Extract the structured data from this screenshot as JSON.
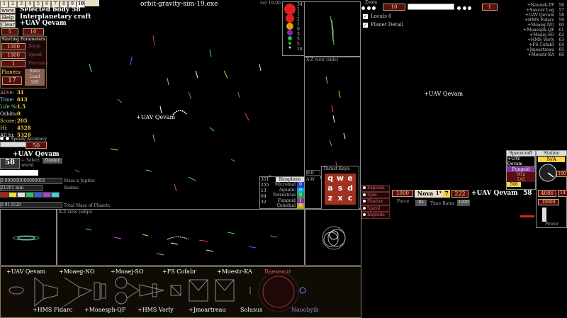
{
  "header": {
    "tabs": [
      "1",
      "2",
      "3",
      "4",
      "5",
      "6",
      "7",
      "8",
      "9",
      "10"
    ],
    "selected_body": "Selected body 58",
    "craft_type": "Interplanetary craft",
    "target_name": "+UAV Qevam",
    "window_title": "orbit-gravity-sim-19.exe",
    "version": "ver 19.00"
  },
  "left_buttons": {
    "www": "www",
    "help": "Help",
    "clear": "Clear"
  },
  "selector": {
    "value_left": "5",
    "value_right": "10"
  },
  "params": {
    "title": "Starting Parameters",
    "rows": [
      {
        "value": "1000",
        "label": "Zoom"
      },
      {
        "value": "1000",
        "label": "Speed"
      },
      {
        "value": "1",
        "label": "Precision"
      }
    ],
    "planets_label": "Planets:",
    "planets_value": "17",
    "save": "Save",
    "load": "Load",
    "hundred": "100"
  },
  "stats": [
    {
      "label": "Alive:",
      "value": "31"
    },
    {
      "label": "Time:",
      "value": "613"
    },
    {
      "label": "Life %:",
      "value": "1.5"
    },
    {
      "label": "Orbits:",
      "value": "0"
    },
    {
      "label": "Score:",
      "value": "205"
    },
    {
      "label": "Hi:",
      "value": "4528"
    },
    {
      "label": "All hi:",
      "value": "5320"
    }
  ],
  "speed_accuracy": {
    "label": "Speed/ Accuracy",
    "value": "50"
  },
  "body_panel": {
    "name": "+UAV Qevam",
    "number": "58",
    "select_world": "← Select\nworld",
    "gamer_tab": "Gamer",
    "mass_text": "Mass x Jupiter",
    "mass_value": "0.000000000000001",
    "radius_value": "21201 mm",
    "radius_text": "Radius",
    "total_mass_value": "0.913528",
    "total_mass_text": "Total Mass of Planets",
    "colors": [
      "#c21818",
      "#f0e020",
      "#e0e0e0",
      "#30c060",
      "#3060e0",
      "#b040c0",
      "#40d0e0"
    ]
  },
  "main_view": {
    "ship_label": "+UAV Qevam"
  },
  "xz_view": {
    "title": "X-Z view (side)"
  },
  "xz_edge": {
    "title": "X-Z view (edge)"
  },
  "legend_values": [
    "34",
    "1",
    "1",
    "2",
    "1",
    "0",
    "3",
    "5",
    "5",
    "16"
  ],
  "right_top": {
    "zoom_label": "Zoom",
    "zoom_value": "10",
    "speed_value": "1",
    "locals_label": "Locals",
    "locals_value": "0",
    "planet_detail": "Planet Detail",
    "ship_label": "+UAV Qevam"
  },
  "ship_list": [
    {
      "name": "+Nauosh-TF",
      "num": "56"
    },
    {
      "name": "+Saucer Lag",
      "num": "57"
    },
    {
      "name": "+UAV Qevam",
      "num": "58"
    },
    {
      "name": "+HMS Fidarc",
      "num": "59"
    },
    {
      "name": "+Moaeg-NO",
      "num": "60"
    },
    {
      "name": "+Moaesph-QF",
      "num": "61"
    },
    {
      "name": "+Moaej-SO",
      "num": "62"
    },
    {
      "name": "+HMS Vorly",
      "num": "63"
    },
    {
      "name": "+FS Cofabr",
      "num": "64"
    },
    {
      "name": "+Jmoartreau",
      "num": "65"
    },
    {
      "name": "+Moestr-KA",
      "num": "66"
    }
  ],
  "biosphere": {
    "title": "Biosphere",
    "left_values": [
      "351",
      "255",
      "13",
      "64",
      "32"
    ],
    "rows": [
      {
        "label": "Microbial",
        "value": "0",
        "color": "#1a40c0"
      },
      {
        "label": "Aquatic",
        "value": "0",
        "color": "#10a0d0"
      },
      {
        "label": "Terrestrial",
        "value": "0",
        "color": "#20a040"
      },
      {
        "label": "Fungoid",
        "value": "1",
        "color": "#8030a0"
      },
      {
        "label": "Celestial",
        "value": "0",
        "color": "#c0a020"
      }
    ],
    "dropdown_value": "0-0",
    "aw": "A-W"
  },
  "thrust": {
    "title": "Thrust Keys:",
    "keys": [
      "q",
      "w",
      "e",
      "a",
      "s",
      "d",
      "z",
      "x",
      "c"
    ]
  },
  "actions": {
    "items": [
      "Explode",
      "Spin",
      "Shatter",
      "Spiral",
      "Implode"
    ],
    "force_value": "1000",
    "force_label": "Force",
    "nova": "Nova",
    "one_star": "1*",
    "seven": "7",
    "big_num": "222",
    "ship_name": "+UAV Qevam",
    "ship_num": "58",
    "time_rates_label": "Time Rates",
    "time_left": "8x",
    "time_right": "1000"
  },
  "spacecraft": {
    "title": "Spacecraft",
    "current": "+UAV Qevam",
    "type": "Fungoid",
    "row3": "Mtn",
    "row4": "Ltd",
    "value": "500"
  },
  "station": {
    "title": "Station",
    "status": "N/A",
    "top_value": "100",
    "mid_value": "4086",
    "right_value": "14",
    "low_value": "10000",
    "power_label": "Power"
  },
  "fleet": {
    "top_labels": [
      "+UAV Qevam",
      "+Moaeg-NO",
      "+Moaej-SO",
      "+FS Cofabr",
      "+Moestr-KA",
      "Baeseaur"
    ],
    "bottom_labels": [
      "+HMS Fidarc",
      "+Moaesph-QF",
      "+HMS Vorly",
      "+Jmoartreau",
      "Solusus",
      "Naoobyib"
    ]
  }
}
